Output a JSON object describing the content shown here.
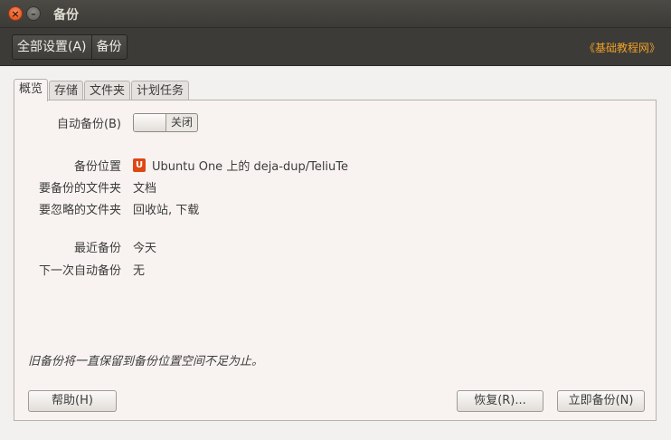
{
  "window": {
    "title": "备份",
    "controls": {
      "close_icon": "×",
      "minimize_icon": "–"
    }
  },
  "header": {
    "breadcrumb": [
      "全部设置(A)",
      "备份"
    ],
    "watermark": "《基础教程网》"
  },
  "tabs": [
    {
      "label": "概览",
      "active": true
    },
    {
      "label": "存储",
      "active": false
    },
    {
      "label": "文件夹",
      "active": false
    },
    {
      "label": "计划任务",
      "active": false
    }
  ],
  "overview": {
    "auto_backup": {
      "label": "自动备份(B)",
      "state": "关闭"
    },
    "backup_location": {
      "label": "备份位置",
      "value": "Ubuntu One 上的 deja-dup/TeliuTe",
      "icon": "ubuntu-one-icon"
    },
    "include_folders": {
      "label": "要备份的文件夹",
      "value": "文档"
    },
    "exclude_folders": {
      "label": "要忽略的文件夹",
      "value": "回收站, 下载"
    },
    "last_backup": {
      "label": "最近备份",
      "value": "今天"
    },
    "next_backup": {
      "label": "下一次自动备份",
      "value": "无"
    },
    "footnote": "旧备份将一直保留到备份位置空间不足为止。"
  },
  "buttons": {
    "help": "帮助(H)",
    "restore": "恢复(R)...",
    "backup_now": "立即备份(N)"
  },
  "colors": {
    "accent": "#dd4814",
    "titlebar": "#3c3b37",
    "panel": "#f8f3f1",
    "watermark": "#f0a028"
  }
}
